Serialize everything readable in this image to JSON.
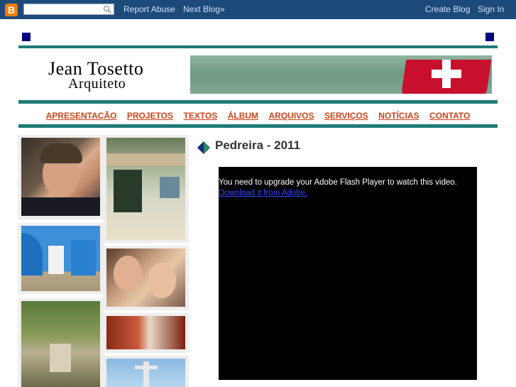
{
  "navbar": {
    "search_placeholder": "",
    "report_abuse": "Report Abuse",
    "next_blog": "Next Blog»",
    "create_blog": "Create Blog",
    "sign_in": "Sign In"
  },
  "header": {
    "title_line1": "Jean Tosetto",
    "title_line2": "Arquiteto"
  },
  "menu": {
    "items": [
      "APRESENTAÇÃO",
      "PROJETOS",
      "TEXTOS",
      "ÁLBUM",
      "ARQUIVOS",
      "SERVIÇOS",
      "NOTÍCIAS",
      "CONTATO"
    ]
  },
  "post": {
    "title": "Pedreira - 2011",
    "flash_message": "You need to upgrade your Adobe Flash Player to watch this video.",
    "flash_link": "Download it from Adobe."
  },
  "colors": {
    "navbar": "#1e4a7a",
    "teal_rule": "#1f7a78",
    "menu_link": "#c8441c",
    "square": "#000080"
  }
}
